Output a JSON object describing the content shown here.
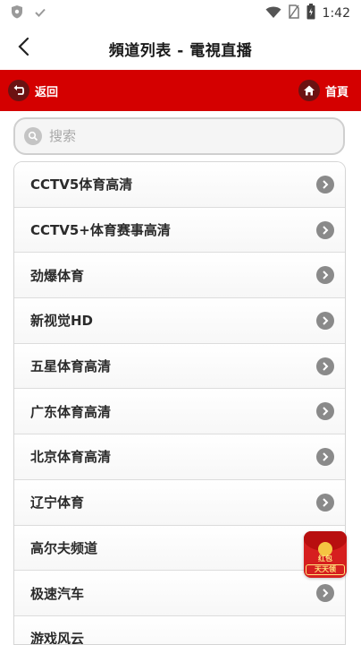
{
  "status_bar": {
    "time": "1:42",
    "icons": [
      "shield-icon",
      "check-icon",
      "wifi-icon",
      "no-sim-icon",
      "battery-icon"
    ]
  },
  "nav": {
    "title": "頻道列表 - 電視直播",
    "back_icon": "chevron-left-icon"
  },
  "toolbar": {
    "back_label": "返回",
    "home_label": "首頁",
    "color": "#d40000"
  },
  "search": {
    "placeholder": "搜索",
    "value": ""
  },
  "channels": [
    {
      "label": "CCTV5体育高清"
    },
    {
      "label": "CCTV5+体育赛事高清"
    },
    {
      "label": "劲爆体育"
    },
    {
      "label": "新视觉HD"
    },
    {
      "label": "五星体育高清"
    },
    {
      "label": "广东体育高清"
    },
    {
      "label": "北京体育高清"
    },
    {
      "label": "辽宁体育"
    },
    {
      "label": "高尔夫频道"
    },
    {
      "label": "极速汽车"
    },
    {
      "label": "游戏风云"
    }
  ],
  "promo": {
    "line1": "红包",
    "line2": "天天领"
  }
}
